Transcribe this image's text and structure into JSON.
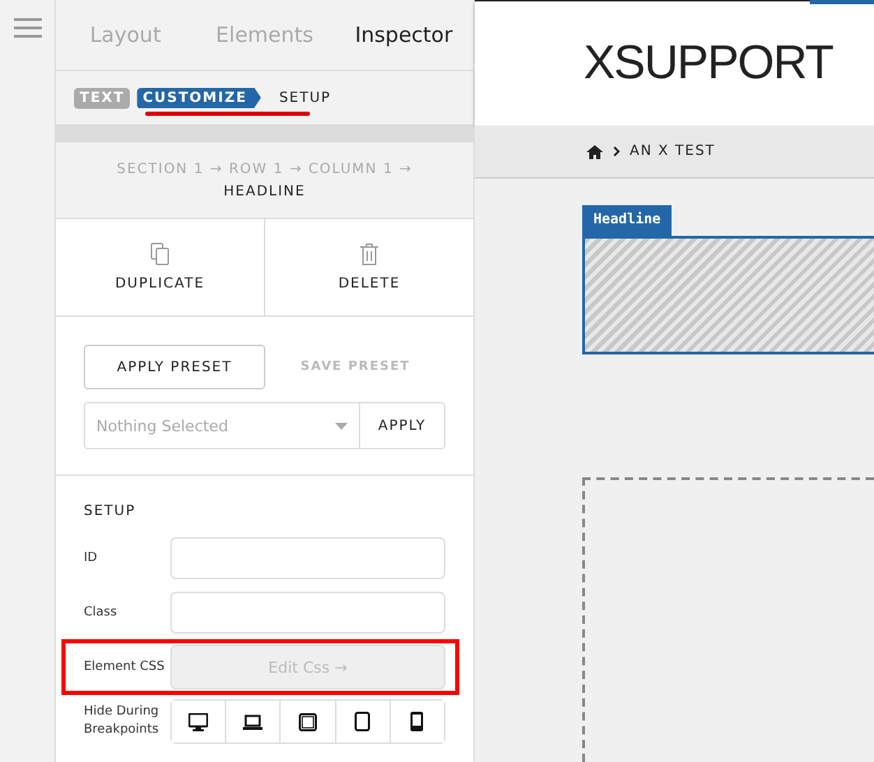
{
  "tabs": [
    {
      "label": "Layout",
      "selected": false
    },
    {
      "label": "Elements",
      "selected": false
    },
    {
      "label": "Inspector",
      "selected": true
    }
  ],
  "crumbs": [
    {
      "label": "TEXT",
      "kind": "chip",
      "underlined": false
    },
    {
      "label": "CUSTOMIZE",
      "kind": "current",
      "underlined": true
    },
    {
      "label": "SETUP",
      "kind": "plain",
      "underlined": false
    }
  ],
  "path": {
    "trail": "SECTION 1 → ROW 1 → COLUMN 1 →",
    "element": "HEADLINE"
  },
  "actions": [
    {
      "label": "DUPLICATE",
      "kind": "duplicate"
    },
    {
      "label": "DELETE",
      "kind": "delete"
    }
  ],
  "presets": {
    "apply_preset": "APPLY PRESET",
    "save_preset": "SAVE PRESET",
    "select_placeholder": "Nothing Selected",
    "apply": "APPLY"
  },
  "setup": {
    "title": "SETUP",
    "fields": [
      {
        "label": "ID",
        "kind": "input",
        "highlighted": false
      },
      {
        "label": "Class",
        "kind": "input",
        "highlighted": false
      },
      {
        "label": "Element CSS",
        "kind": "button",
        "button": "Edit Css →",
        "highlighted": true
      },
      {
        "label": "Hide During Breakpoints",
        "kind": "breakpoints",
        "highlighted": false,
        "devices": [
          {
            "kind": "desktop"
          },
          {
            "kind": "laptop"
          },
          {
            "kind": "tablet-landscape"
          },
          {
            "kind": "tablet"
          },
          {
            "kind": "phone"
          }
        ]
      }
    ]
  },
  "preview": {
    "site_title": "XSUPPORT",
    "breadcrumb": "AN X TEST",
    "element_tab": "Headline"
  }
}
